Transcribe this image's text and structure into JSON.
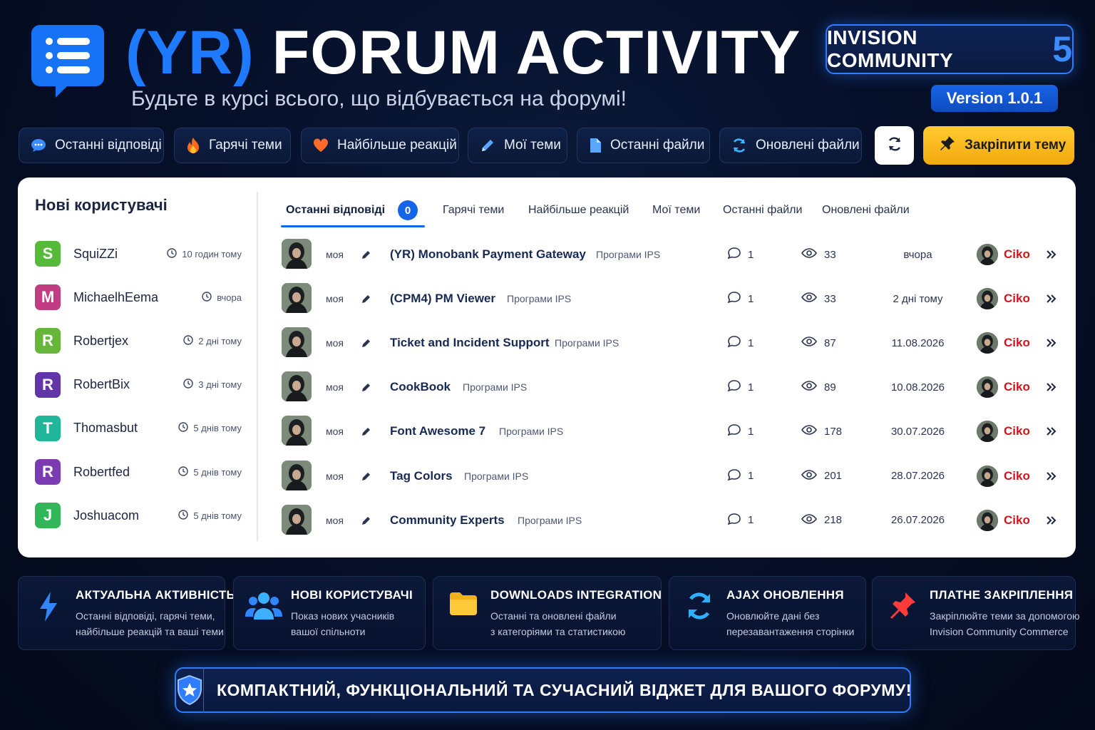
{
  "header": {
    "title_prefix": "(YR)",
    "title_main": "FORUM ACTIVITY",
    "subtitle": "Будьте в курсі всього, що відбувається на форумі!",
    "brand_text": "INVISION COMMUNITY",
    "brand_number": "5",
    "version": "Version 1.0.1"
  },
  "toolbar": {
    "tabs": [
      {
        "label": "Останні відповіді",
        "icon": "chat-bubble-icon"
      },
      {
        "label": "Гарячі теми",
        "icon": "fire-icon"
      },
      {
        "label": "Найбільше реакцій",
        "icon": "heart-icon"
      },
      {
        "label": "Мої теми",
        "icon": "pencil-icon"
      },
      {
        "label": "Останні файли",
        "icon": "file-icon"
      },
      {
        "label": "Оновлені файли",
        "icon": "sync-icon"
      }
    ],
    "refresh_icon": "refresh-icon",
    "pin_label": "Закріпити тему"
  },
  "users": {
    "title": "Нові користувачі",
    "items": [
      {
        "initial": "S",
        "name": "SquiZZi",
        "time": "10 годин тому",
        "color": "#56b93a"
      },
      {
        "initial": "M",
        "name": "MichaelhEema",
        "time": "вчора",
        "color": "#c23c84"
      },
      {
        "initial": "R",
        "name": "Robertjex",
        "time": "2 дні тому",
        "color": "#67b53a"
      },
      {
        "initial": "R",
        "name": "RobertBix",
        "time": "3 дні тому",
        "color": "#6236a8"
      },
      {
        "initial": "T",
        "name": "Thomasbut",
        "time": "5 днів тому",
        "color": "#1fb69a"
      },
      {
        "initial": "R",
        "name": "Robertfed",
        "time": "5 днів тому",
        "color": "#7a3cb0"
      },
      {
        "initial": "J",
        "name": "Joshuacom",
        "time": "5 днів тому",
        "color": "#2fb75a"
      }
    ]
  },
  "content_tabs": {
    "items": [
      "Останні відповіді",
      "Гарячі теми",
      "Найбільше реакцій",
      "Мої теми",
      "Останні файли",
      "Оновлені файли"
    ],
    "active_count": "0"
  },
  "topics": [
    {
      "mine": "моя",
      "title": "(YR) Monobank Payment Gateway",
      "category": "Програми IPS",
      "comments": "1",
      "views": "33",
      "date": "вчора",
      "author": "Ciko"
    },
    {
      "mine": "моя",
      "title": "(CPM4) PM Viewer",
      "category": "Програми IPS",
      "comments": "1",
      "views": "33",
      "date": "2 дні тому",
      "author": "Ciko"
    },
    {
      "mine": "моя",
      "title": "Ticket and Incident Support",
      "category": "Програми IPS",
      "comments": "1",
      "views": "87",
      "date": "11.08.2026",
      "author": "Ciko"
    },
    {
      "mine": "моя",
      "title": "CookBook",
      "category": "Програми IPS",
      "comments": "1",
      "views": "89",
      "date": "10.08.2026",
      "author": "Ciko"
    },
    {
      "mine": "моя",
      "title": "Font Awesome 7",
      "category": "Програми IPS",
      "comments": "1",
      "views": "178",
      "date": "30.07.2026",
      "author": "Ciko"
    },
    {
      "mine": "моя",
      "title": "Tag Colors",
      "category": "Програми IPS",
      "comments": "1",
      "views": "201",
      "date": "28.07.2026",
      "author": "Ciko"
    },
    {
      "mine": "моя",
      "title": "Community Experts",
      "category": "Програми IPS",
      "comments": "1",
      "views": "218",
      "date": "26.07.2026",
      "author": "Ciko"
    }
  ],
  "features": [
    {
      "icon": "lightning-icon",
      "title": "АКТУАЛЬНА АКТИВНІСТЬ",
      "line1": "Останні відповіді, гарячі теми,",
      "line2": "найбільше реакцій та ваші теми"
    },
    {
      "icon": "users-icon",
      "title": "НОВІ КОРИСТУВАЧІ",
      "line1": "Показ нових учасників",
      "line2": "вашої спільноти"
    },
    {
      "icon": "folder-icon",
      "title": "DOWNLOADS INTEGRATION",
      "line1": "Останні та оновлені файли",
      "line2": "з категоріями та статистикою"
    },
    {
      "icon": "sync-icon",
      "title": "AJAX ОНОВЛЕННЯ",
      "line1": "Оновлюйте дані без",
      "line2": "перезавантаження сторінки"
    },
    {
      "icon": "pushpin-icon",
      "title": "ПЛАТНЕ ЗАКРІПЛЕННЯ",
      "line1": "Закріплюйте теми за допомогою",
      "line2": "Invision Community Commerce"
    }
  ],
  "banner": {
    "text": "КОМПАКТНИЙ, ФУНКЦІОНАЛЬНИЙ ТА СУЧАСНИЙ ВІДЖЕТ ДЛЯ ВАШОГО ФОРУМУ!"
  },
  "colors": {
    "accent": "#1e7bff",
    "pin": "#f5b514",
    "author": "#d4131d"
  }
}
